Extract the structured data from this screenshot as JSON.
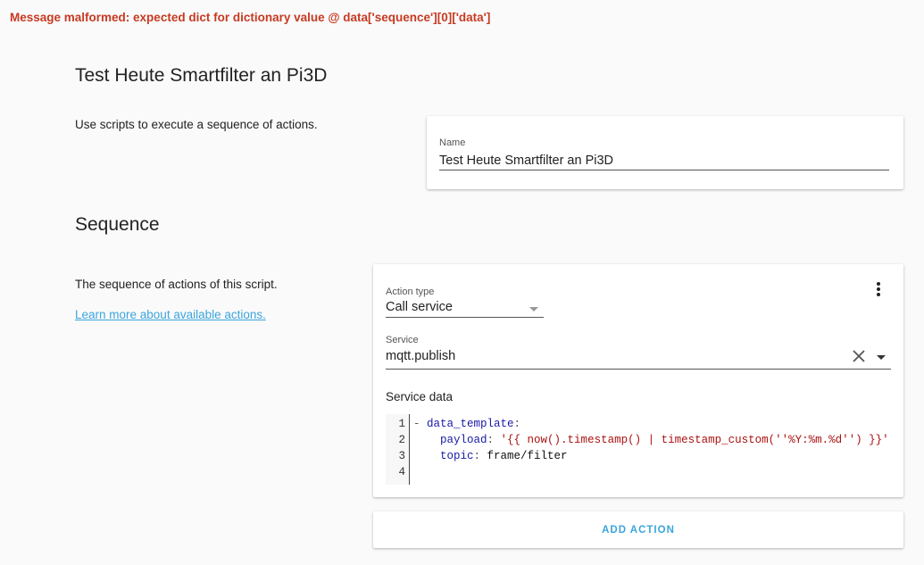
{
  "error": {
    "message": "Message malformed: expected dict for dictionary value @ data['sequence'][0]['data']"
  },
  "script": {
    "title": "Test Heute Smartfilter an Pi3D",
    "description": "Use scripts to execute a sequence of actions.",
    "name_label": "Name",
    "name_value": "Test Heute Smartfilter an Pi3D"
  },
  "sequence": {
    "heading": "Sequence",
    "description": "The sequence of actions of this script.",
    "learn_more_link": "Learn more about available actions."
  },
  "action": {
    "type_label": "Action type",
    "type_value": "Call service",
    "service_label": "Service",
    "service_value": "mqtt.publish",
    "service_data_label": "Service data",
    "code": {
      "line_numbers": [
        "1",
        "2",
        "3",
        "4"
      ],
      "lines": [
        {
          "parts": [
            {
              "t": "- ",
              "c": "punct"
            },
            {
              "t": "data_template",
              "c": "key"
            },
            {
              "t": ":",
              "c": "punct"
            }
          ]
        },
        {
          "parts": [
            {
              "t": "    ",
              "c": "plain"
            },
            {
              "t": "payload",
              "c": "key"
            },
            {
              "t": ": ",
              "c": "punct"
            },
            {
              "t": "'{{ now().timestamp() | timestamp_custom(''%Y:%m.%d'') }}'",
              "c": "str"
            }
          ]
        },
        {
          "parts": [
            {
              "t": "    ",
              "c": "plain"
            },
            {
              "t": "topic",
              "c": "key"
            },
            {
              "t": ": ",
              "c": "punct"
            },
            {
              "t": "frame/filter",
              "c": "plain"
            }
          ]
        },
        {
          "parts": []
        }
      ]
    },
    "menu_icon": "more-vertical-icon"
  },
  "add_action": {
    "label": "ADD ACTION"
  },
  "colors": {
    "error": "#c73a22",
    "link": "#3ba5dc",
    "background": "#fafafa",
    "yaml_key": "#1a1aa6",
    "yaml_string": "#aa1111"
  }
}
